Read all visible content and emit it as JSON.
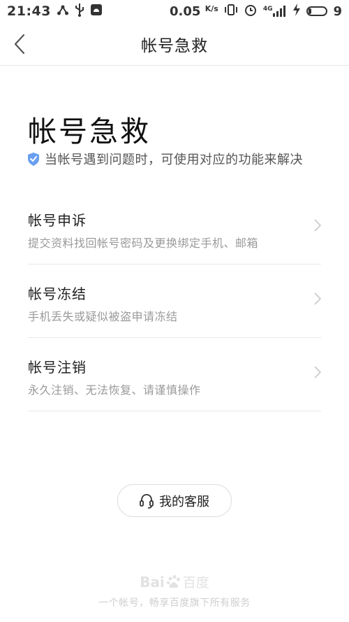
{
  "status_bar": {
    "time": "21:43",
    "speed_value": "0.05",
    "speed_unit": "K/s",
    "network_label": "4G",
    "battery_level": "9"
  },
  "navbar": {
    "title": "帐号急救"
  },
  "main": {
    "title": "帐号急救",
    "subtitle": "当帐号遇到问题时，可使用对应的功能来解决",
    "items": [
      {
        "label": "帐号申诉",
        "desc": "提交资料找回帐号密码及更换绑定手机、邮箱"
      },
      {
        "label": "帐号冻结",
        "desc": "手机丢失或疑似被盗申请冻结"
      },
      {
        "label": "帐号注销",
        "desc": "永久注销、无法恢复、请谨慎操作"
      }
    ]
  },
  "service_button": {
    "label": "我的客服"
  },
  "footer": {
    "logo_text": "Bai",
    "logo_text2": "百度",
    "text": "一个帐号，畅享百度旗下所有服务"
  },
  "colors": {
    "shield": "#6a9ff0",
    "chevron": "#c8c8c8"
  }
}
